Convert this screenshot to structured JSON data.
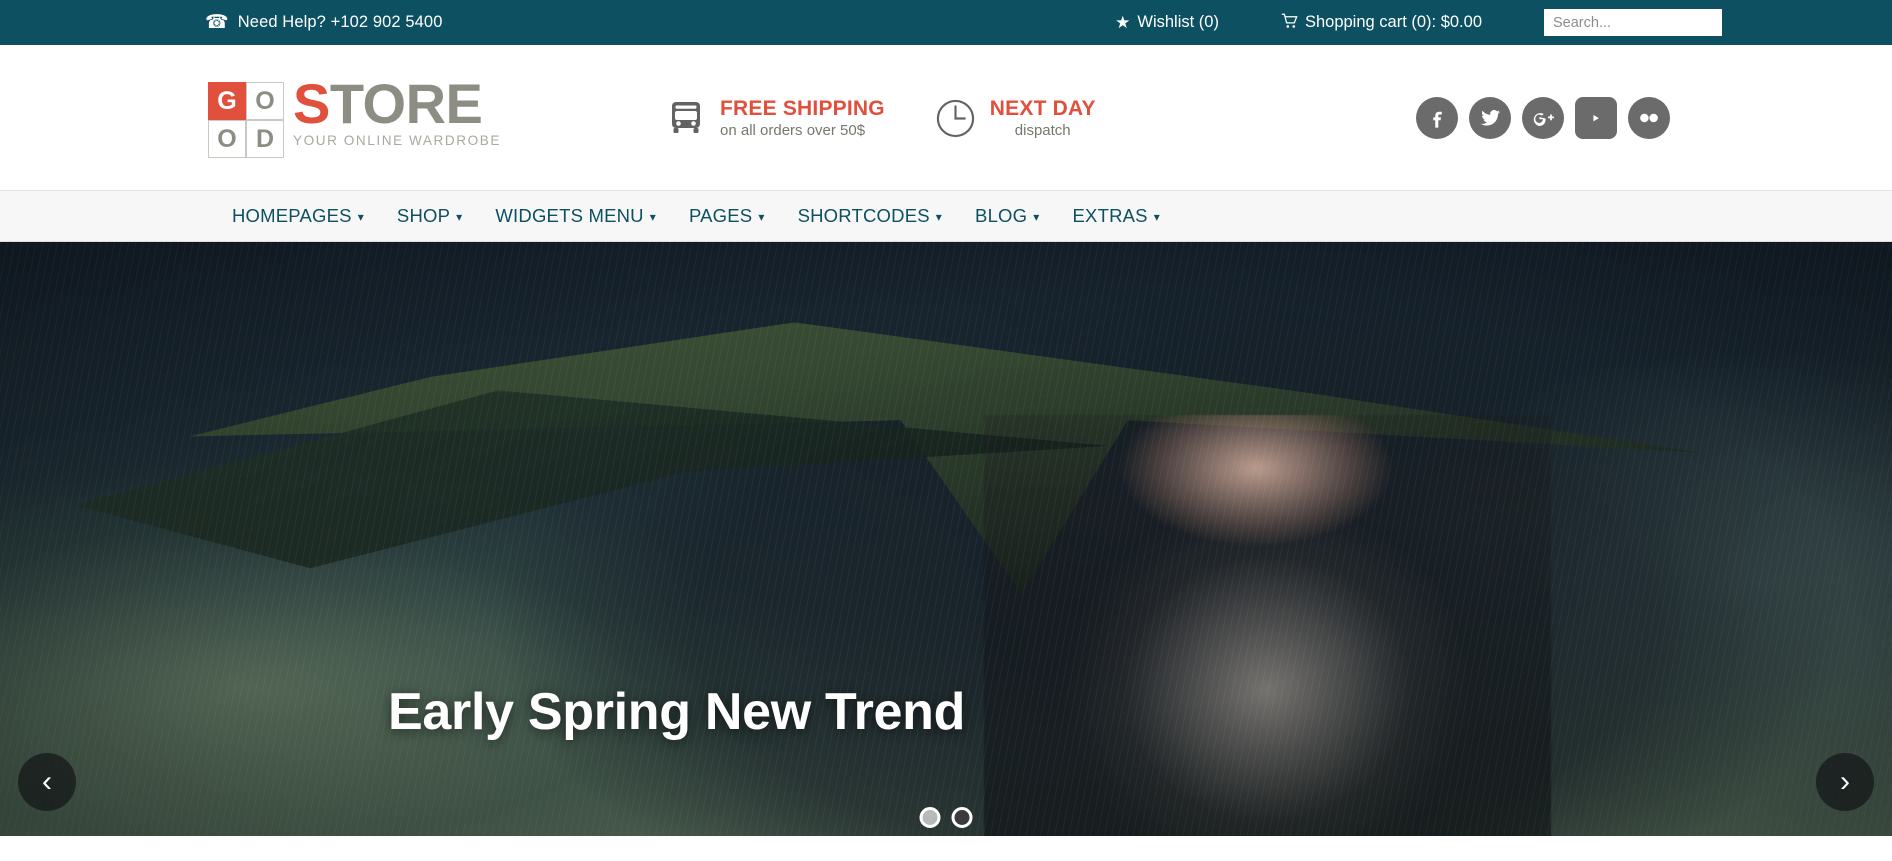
{
  "topbar": {
    "phone_icon": "phone-icon",
    "phone_text": "Need Help? +102 902 5400",
    "wishlist_icon": "star-icon",
    "wishlist_label": "Wishlist (0)",
    "cart_icon": "shopping-cart-icon",
    "cart_label": "Shopping cart (0): $0.00",
    "search_placeholder": "Search...",
    "search_value": "",
    "search_icon": "search-icon",
    "bg_color": "#0d5061"
  },
  "header": {
    "logo": {
      "grid": [
        "G",
        "O",
        "O",
        "D"
      ],
      "word_first": "S",
      "word_rest": "TORE",
      "tagline": "YOUR ONLINE WARDROBE",
      "accent_color": "#e0503c",
      "neutral_color": "#8d8d83"
    },
    "promos": [
      {
        "icon": "truck-icon",
        "title": "FREE SHIPPING",
        "subtitle": "on all orders over 50$"
      },
      {
        "icon": "clock-icon",
        "title": "NEXT DAY",
        "subtitle": "dispatch"
      }
    ],
    "socials": [
      {
        "icon": "facebook-icon",
        "name": "Facebook"
      },
      {
        "icon": "twitter-icon",
        "name": "Twitter"
      },
      {
        "icon": "google-plus-icon",
        "name": "Google Plus"
      },
      {
        "icon": "youtube-icon",
        "name": "YouTube"
      },
      {
        "icon": "flickr-icon",
        "name": "Flickr"
      }
    ]
  },
  "nav": {
    "items": [
      {
        "label": "HOMEPAGES",
        "has_dropdown": true
      },
      {
        "label": "SHOP",
        "has_dropdown": true
      },
      {
        "label": "WIDGETS MENU",
        "has_dropdown": true
      },
      {
        "label": "PAGES",
        "has_dropdown": true
      },
      {
        "label": "SHORTCODES",
        "has_dropdown": true
      },
      {
        "label": "BLOG",
        "has_dropdown": true
      },
      {
        "label": "EXTRAS",
        "has_dropdown": true
      }
    ],
    "link_color": "#0d5061"
  },
  "hero": {
    "caption": "Early Spring New Trend",
    "prev_icon": "chevron-left-icon",
    "next_icon": "chevron-right-icon",
    "prev_glyph": "‹",
    "next_glyph": "›",
    "dots": [
      {
        "active": false
      },
      {
        "active": true
      }
    ],
    "slide_count": 2,
    "current_slide": 1
  }
}
